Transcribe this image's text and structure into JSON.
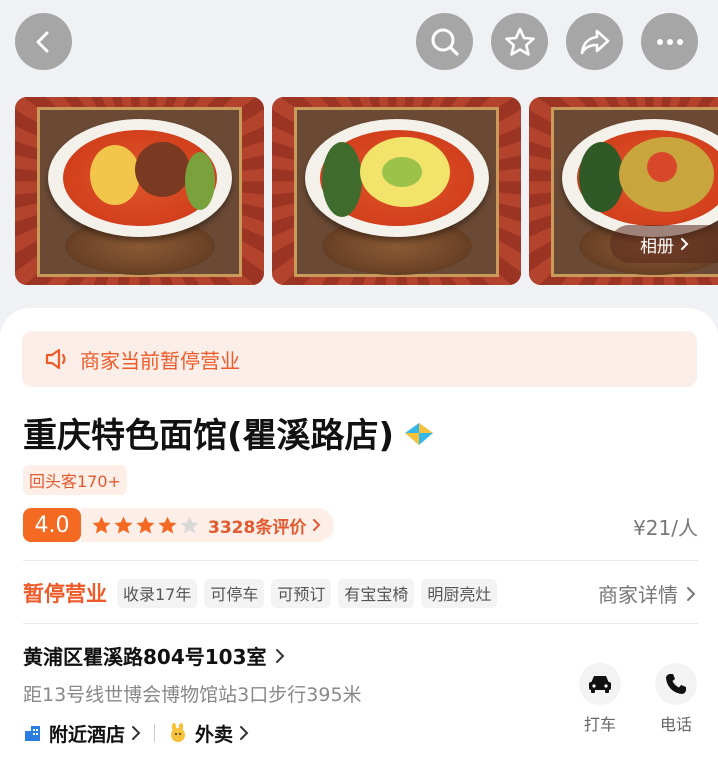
{
  "header": {
    "back_icon": "chevron-left-icon",
    "search_icon": "search-icon",
    "favorite_icon": "star-outline-icon",
    "share_icon": "share-arrow-icon",
    "more_icon": "more-dots-icon"
  },
  "gallery": {
    "album_label": "相册",
    "photo_count_visible": 3
  },
  "notice": {
    "text": "商家当前暂停营业"
  },
  "shop": {
    "name": "重庆特色面馆(瞿溪路店)",
    "returning_badge": "回头客170+",
    "score": "4.0",
    "stars_filled": 4,
    "stars_total": 5,
    "reviews": "3328条评价",
    "price": "¥21/人"
  },
  "status_row": {
    "status": "暂停营业",
    "tags": [
      "收录17年",
      "可停车",
      "可预订",
      "有宝宝椅",
      "明厨亮灶"
    ],
    "detail_link": "商家详情"
  },
  "location": {
    "address": "黄浦区瞿溪路804号103室",
    "distance": "距13号线世博会博物馆站3口步行395米",
    "hotel_link": "附近酒店",
    "takeout_link": "外卖"
  },
  "actions": {
    "taxi": "打车",
    "phone": "电话"
  },
  "colors": {
    "accent": "#f46a23",
    "accent_text": "#e25a2f",
    "notice_bg": "#fbeee8"
  }
}
